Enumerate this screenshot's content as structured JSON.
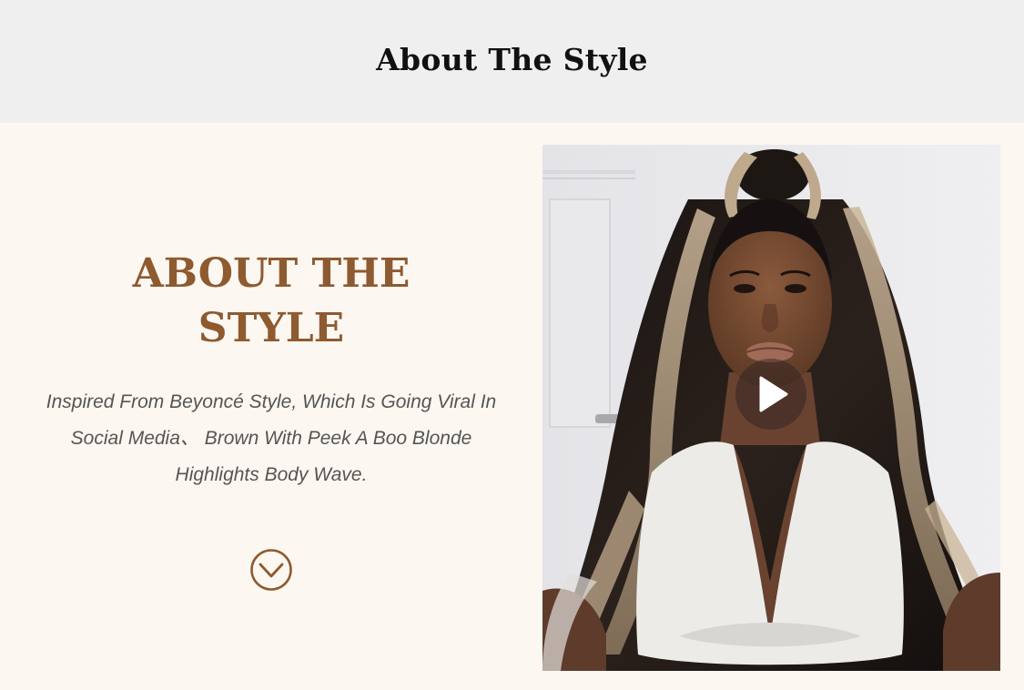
{
  "header": {
    "title": "About The Style"
  },
  "section": {
    "heading_line1": "ABOUT THE",
    "heading_line2": "STYLE",
    "description": "Inspired From Beyoncé Style, Which Is Going Viral In Social Media、 Brown With Peek A Boo Blonde Highlights Body Wave.",
    "scroll_icon": "chevron-down-circle-icon"
  },
  "video": {
    "play_icon": "play-icon"
  },
  "colors": {
    "header_band": "#efefef",
    "page_background": "#fcf7f1",
    "accent_brown": "#8e5a30",
    "body_text": "#555555"
  }
}
